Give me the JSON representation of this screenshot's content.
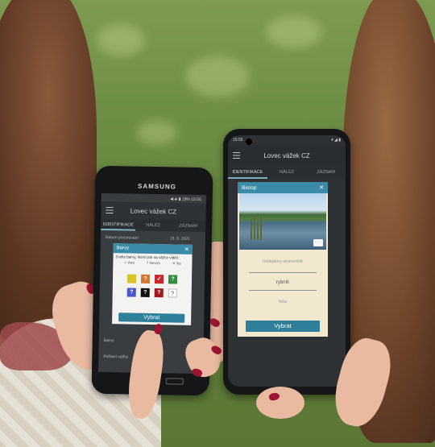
{
  "left_phone": {
    "brand": "SAMSUNG",
    "status_right": "◀ ◈ ▮ 19% 15:55",
    "app_title": "Lovec vážek CZ",
    "tabs": [
      "IDENTIFIKACE",
      "NÁLEZ",
      "ZÁZNAM"
    ],
    "rows": [
      "Datum pozorování",
      "Barvy",
      "Pohlaví vážky"
    ],
    "date_value": "15. 9. 2021",
    "dialog": {
      "title": "Barvy",
      "prompt": "Zvolte barvy, které jste na vážce viděli:",
      "legend": [
        {
          "mark": "✓",
          "label": "Ano"
        },
        {
          "mark": "?",
          "label": "Nevím"
        },
        {
          "mark": "✕",
          "label": "Ne"
        }
      ],
      "swatches": [
        {
          "color": "#d9c22a",
          "mark": ""
        },
        {
          "color": "#d7772d",
          "mark": "?"
        },
        {
          "color": "#c8262d",
          "mark": "✓"
        },
        {
          "color": "#2f8f3a",
          "mark": "?"
        },
        {
          "color": "#4b57c7",
          "mark": "?"
        },
        {
          "color": "#111111",
          "mark": "?"
        },
        {
          "color": "#a0191f",
          "mark": "?"
        },
        {
          "color": "#ffffff",
          "mark": "?"
        }
      ],
      "button": "Vybrat"
    }
  },
  "right_phone": {
    "status_left": "15:55",
    "status_right": "▾ ◢ ▮",
    "app_title": "Lovec vážek CZ",
    "tabs": [
      "IDENTIFIKACE",
      "NÁLEZ",
      "ZÁZNAM"
    ],
    "dialog": {
      "title": "Biotop",
      "field_placeholder": "Indikátory stanoviště",
      "field_value": "rybník",
      "field_hint": "řeka",
      "button": "Vybrat"
    }
  },
  "colors": {
    "accent": "#3a8aa8",
    "button": "#2d7f9a",
    "app_dark": "#2e3236"
  }
}
